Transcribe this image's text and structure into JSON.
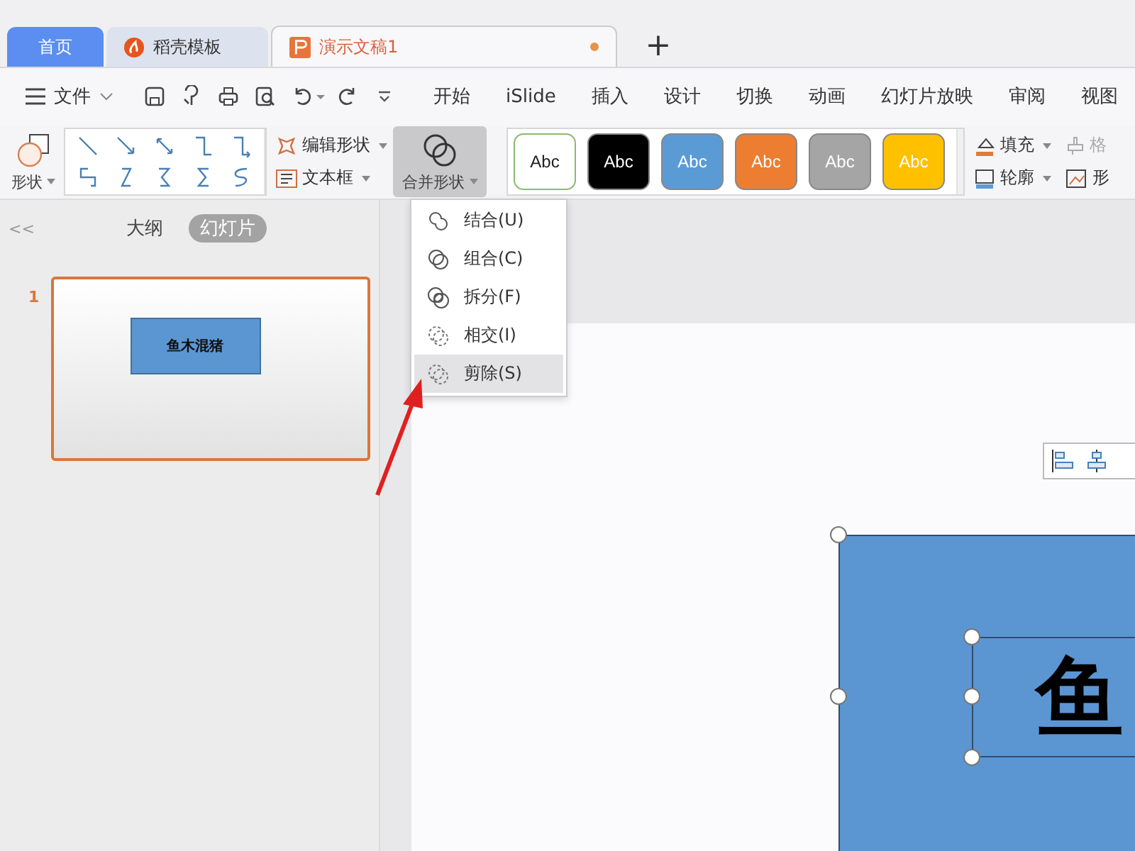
{
  "tabs": [
    {
      "label": "首页",
      "kind": "home",
      "selected": false
    },
    {
      "label": "稻壳模板",
      "kind": "template",
      "selected": false
    },
    {
      "label": "演示文稿1",
      "kind": "document",
      "selected": true,
      "modified": true
    }
  ],
  "new_tab": "+",
  "menu": {
    "file": "文件",
    "items": [
      "开始",
      "iSlide",
      "插入",
      "设计",
      "切换",
      "动画",
      "幻灯片放映",
      "审阅",
      "视图"
    ]
  },
  "ribbon": {
    "shapes": "形状",
    "edit_shape": "编辑形状",
    "text_box": "文本框",
    "merge_shapes": {
      "label": "合并形状",
      "expanded": true
    },
    "styles": [
      {
        "label": "Abc",
        "kind": "outline",
        "color": "#ffffff"
      },
      {
        "label": "Abc",
        "kind": "filled",
        "color": "#000000"
      },
      {
        "label": "Abc",
        "kind": "filled",
        "color": "#5b9bd5"
      },
      {
        "label": "Abc",
        "kind": "filled",
        "color": "#ed7d31"
      },
      {
        "label": "Abc",
        "kind": "filled",
        "color": "#a5a5a5"
      },
      {
        "label": "Abc",
        "kind": "filled",
        "color": "#ffc000"
      }
    ],
    "fill": "填充",
    "outline": "轮廓",
    "format": {
      "label": "格",
      "disabled": true
    },
    "effects": {
      "label": "形",
      "disabled": false
    }
  },
  "merge_menu": [
    {
      "label": "结合(U)",
      "selected": false
    },
    {
      "label": "组合(C)",
      "selected": false
    },
    {
      "label": "拆分(F)",
      "selected": false
    },
    {
      "label": "相交(I)",
      "selected": false
    },
    {
      "label": "剪除(S)",
      "selected": true
    }
  ],
  "panel": {
    "collapse": "<<",
    "views": [
      {
        "label": "大纲",
        "selected": false
      },
      {
        "label": "幻灯片",
        "selected": true
      }
    ],
    "slides": [
      {
        "number": "1",
        "selected": true,
        "shape_text": "鱼木混猪"
      }
    ]
  },
  "canvas": {
    "shape_text": "鱼"
  }
}
